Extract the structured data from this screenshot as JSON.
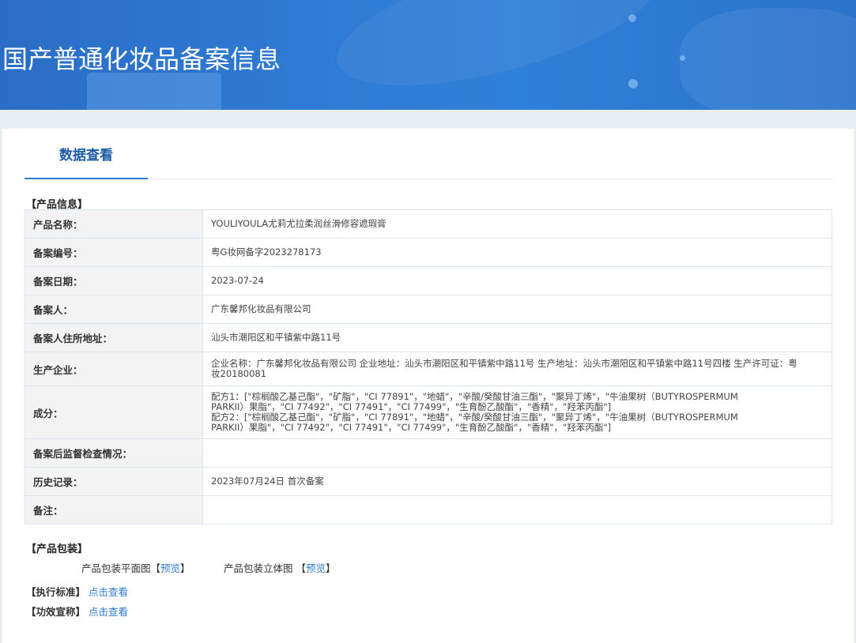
{
  "header": {
    "title": "国产普通化妆品备案信息"
  },
  "tabs": [
    {
      "label": "数据查看"
    }
  ],
  "product_info": {
    "section_title": "【产品信息】",
    "rows": [
      {
        "label": "产品名称：",
        "value": "YOULIYOULA尤莉尤拉柔润丝滑修容遮瑕膏"
      },
      {
        "label": "备案编号：",
        "value": "粤G妆网备字2023278173"
      },
      {
        "label": "备案日期：",
        "value": "2023-07-24"
      },
      {
        "label": "备案人：",
        "value": "广东馨邦化妆品有限公司"
      },
      {
        "label": "备案人住所地址：",
        "value": "汕头市潮阳区和平镇紫中路11号"
      },
      {
        "label": "生产企业：",
        "value": "企业名称：广东馨邦化妆品有限公司 企业地址：汕头市潮阳区和平镇紫中路11号 生产地址：汕头市潮阳区和平镇紫中路11号四楼 生产许可证：粤妆20180081"
      },
      {
        "label": "成分：",
        "value": "配方1：[\"棕榈酸乙基己酯\"，\"矿脂\"，\"CI 77891\"，\"地蜡\"，\"辛酸/癸酸甘油三酯\"，\"聚异丁烯\"，\"牛油果树（BUTYROSPERMUM PARKII）果脂\"，\"CI 77492\"，\"CI 77491\"，\"CI 77499\"，\"生育酚乙酸酯\"，\"香精\"，\"羟苯丙酯\"]",
        "value2": "配方2：[\"棕榈酸乙基己酯\"，\"矿脂\"，\"CI 77891\"，\"地蜡\"，\"辛酸/癸酸甘油三酯\"，\"聚异丁烯\"，\"牛油果树（BUTYROSPERMUM PARKII）果脂\"，\"CI 77492\"，\"CI 77491\"，\"CI 77499\"，\"生育酚乙酸酯\"，\"香精\"，\"羟苯丙酯\"]"
      },
      {
        "label": "备案后监督检查情况：",
        "value": ""
      },
      {
        "label": "历史记录：",
        "value": "2023年07月24日 首次备案"
      },
      {
        "label": "备注：",
        "value": ""
      }
    ]
  },
  "packaging": {
    "section_title": "【产品包装】",
    "flat_label": "产品包装平面图",
    "flat_link": "预览",
    "solid_label": "产品包装立体图",
    "solid_link": "预览",
    "bracket_open": "【",
    "bracket_close": "】"
  },
  "standards": {
    "label": "【执行标准】",
    "link": "点击查看"
  },
  "efficacy": {
    "label": "【功效宣称】",
    "link": "点击查看"
  },
  "colors": {
    "banner": "#2f7ad4",
    "accent": "#2d7bd1",
    "tab_text": "#1e5aa8",
    "table_border": "#9fc0e4"
  }
}
